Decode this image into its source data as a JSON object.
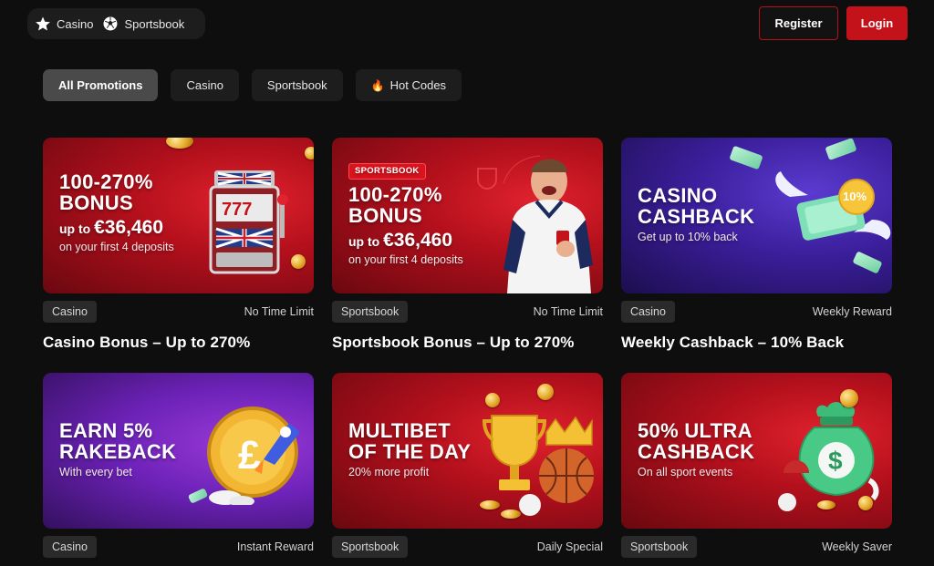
{
  "header": {
    "nav": [
      {
        "label": "Casino",
        "icon": "star-icon"
      },
      {
        "label": "Sportsbook",
        "icon": "soccer-ball-icon"
      }
    ],
    "register_label": "Register",
    "login_label": "Login"
  },
  "filters": [
    {
      "label": "All Promotions",
      "active": true
    },
    {
      "label": "Casino",
      "active": false
    },
    {
      "label": "Sportsbook",
      "active": false
    },
    {
      "label": "Hot Codes",
      "active": false,
      "icon": "flame-icon"
    }
  ],
  "colors": {
    "accent": "#c4121b",
    "background": "#0e0e0e",
    "chip": "#1d1d1d"
  },
  "cards": [
    {
      "banner_headline_1": "100-270%",
      "banner_headline_2": "BONUS",
      "banner_amount_prefix": "up to",
      "banner_amount": "€36,460",
      "banner_sub": "on your first 4 deposits",
      "tag": "Casino",
      "meta": "No Time Limit",
      "title": "Casino Bonus – Up to 270%",
      "art": "slot-machine-icon"
    },
    {
      "banner_badge": "SPORTSBOOK",
      "banner_headline_1": "100-270%",
      "banner_headline_2": "BONUS",
      "banner_amount_prefix": "up to",
      "banner_amount": "€36,460",
      "banner_sub": "on your first 4 deposits",
      "tag": "Sportsbook",
      "meta": "No Time Limit",
      "title": "Sportsbook Bonus – Up to 270%",
      "art": "football-player-icon"
    },
    {
      "banner_headline_1": "CASINO",
      "banner_headline_2": "CASHBACK",
      "banner_sub": "Get up to 10% back",
      "badge_text": "10%",
      "tag": "Casino",
      "meta": "Weekly Reward",
      "title": "Weekly Cashback – 10% Back",
      "art": "winged-cash-icon"
    },
    {
      "banner_headline_1": "EARN 5%",
      "banner_headline_2": "RAKEBACK",
      "banner_sub": "With every bet",
      "tag": "Casino",
      "meta": "Instant Reward",
      "art": "rocket-coin-icon"
    },
    {
      "banner_headline_1": "MULTIBET",
      "banner_headline_2": "OF THE DAY",
      "banner_sub": "20% more profit",
      "tag": "Sportsbook",
      "meta": "Daily Special",
      "art": "trophy-icon"
    },
    {
      "banner_headline_1": "50% ULTRA",
      "banner_headline_2": "CASHBACK",
      "banner_sub": "On all sport events",
      "tag": "Sportsbook",
      "meta": "Weekly Saver",
      "art": "money-bag-icon"
    }
  ]
}
